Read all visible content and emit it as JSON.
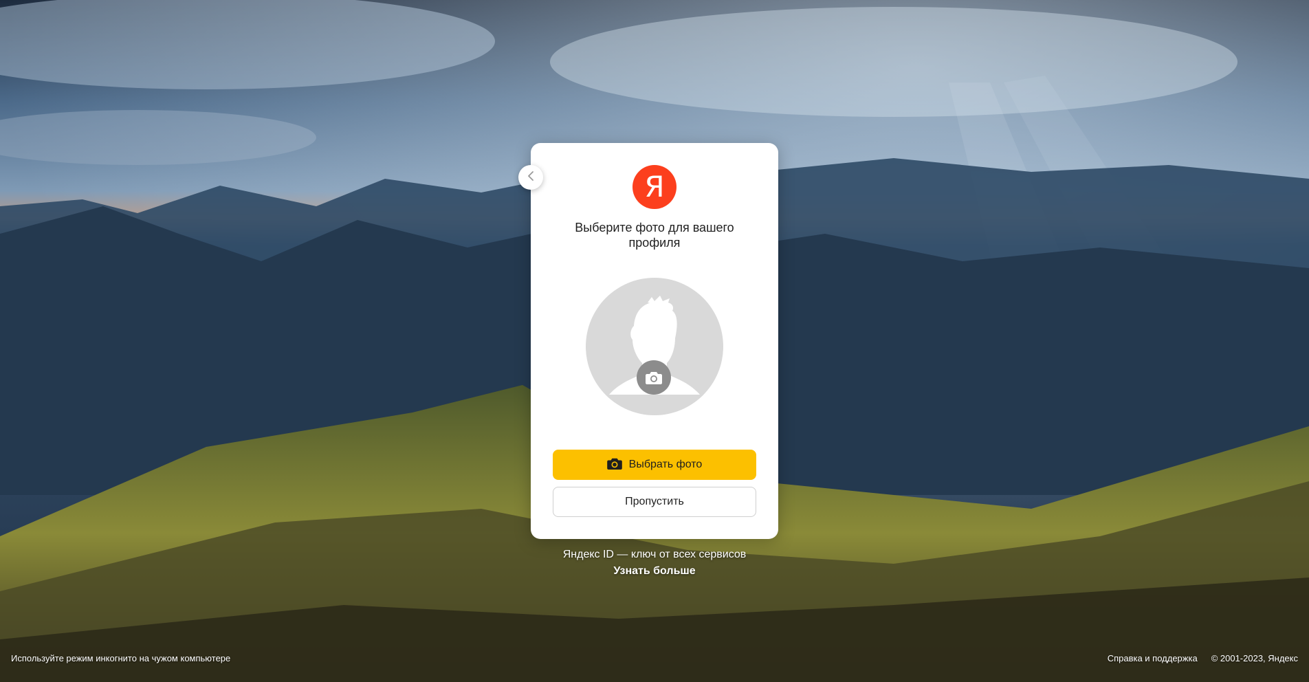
{
  "background": {
    "description_icon": "mountain-landscape-image"
  },
  "card": {
    "back_icon": "chevron-left-icon",
    "logo_letter": "Я",
    "logo_color": "#fc3f1d",
    "title": "Выберите фото для вашего профиля",
    "avatar_icon": "default-avatar-silhouette-icon",
    "camera_icon": "camera-icon",
    "primary_button": {
      "label": "Выбрать фото",
      "icon": "camera-icon",
      "color": "#fcc000"
    },
    "secondary_button": {
      "label": "Пропустить"
    }
  },
  "promo": {
    "tagline": "Яндекс ID — ключ от всех сервисов",
    "learn_more": "Узнать больше"
  },
  "footer": {
    "incognito_hint": "Используйте режим инкогнито на чужом компьютере",
    "help_link": "Справка и поддержка",
    "copyright": "© 2001-2023, Яндекс"
  }
}
